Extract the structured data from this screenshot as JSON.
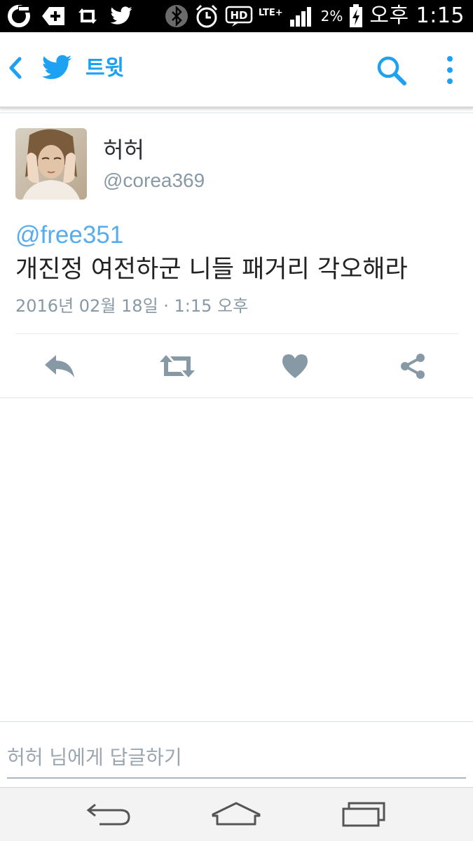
{
  "status_bar": {
    "network": "LTE+",
    "battery_percent": "2%",
    "time": "오후 1:15",
    "hd_label": "HD",
    "left_icons": [
      "olleh-icon",
      "plus-icon",
      "retweet-notification-icon",
      "twitter-notification-icon"
    ]
  },
  "app_bar": {
    "title": "트윗"
  },
  "tweet": {
    "name": "허허",
    "handle": "@corea369",
    "mention": "@free351",
    "text": "개진정 여전하군 니들 패거리 각오해라",
    "timestamp": "2016년 02월 18일 · 1:15 오후"
  },
  "actions": [
    "reply-icon",
    "retweet-icon",
    "like-icon",
    "share-icon"
  ],
  "reply": {
    "placeholder": "허허 님에게 답글하기"
  },
  "colors": {
    "accent": "#1da1f2",
    "mention": "#55acee",
    "muted": "#8899a6",
    "action_icon": "#8899a6"
  }
}
